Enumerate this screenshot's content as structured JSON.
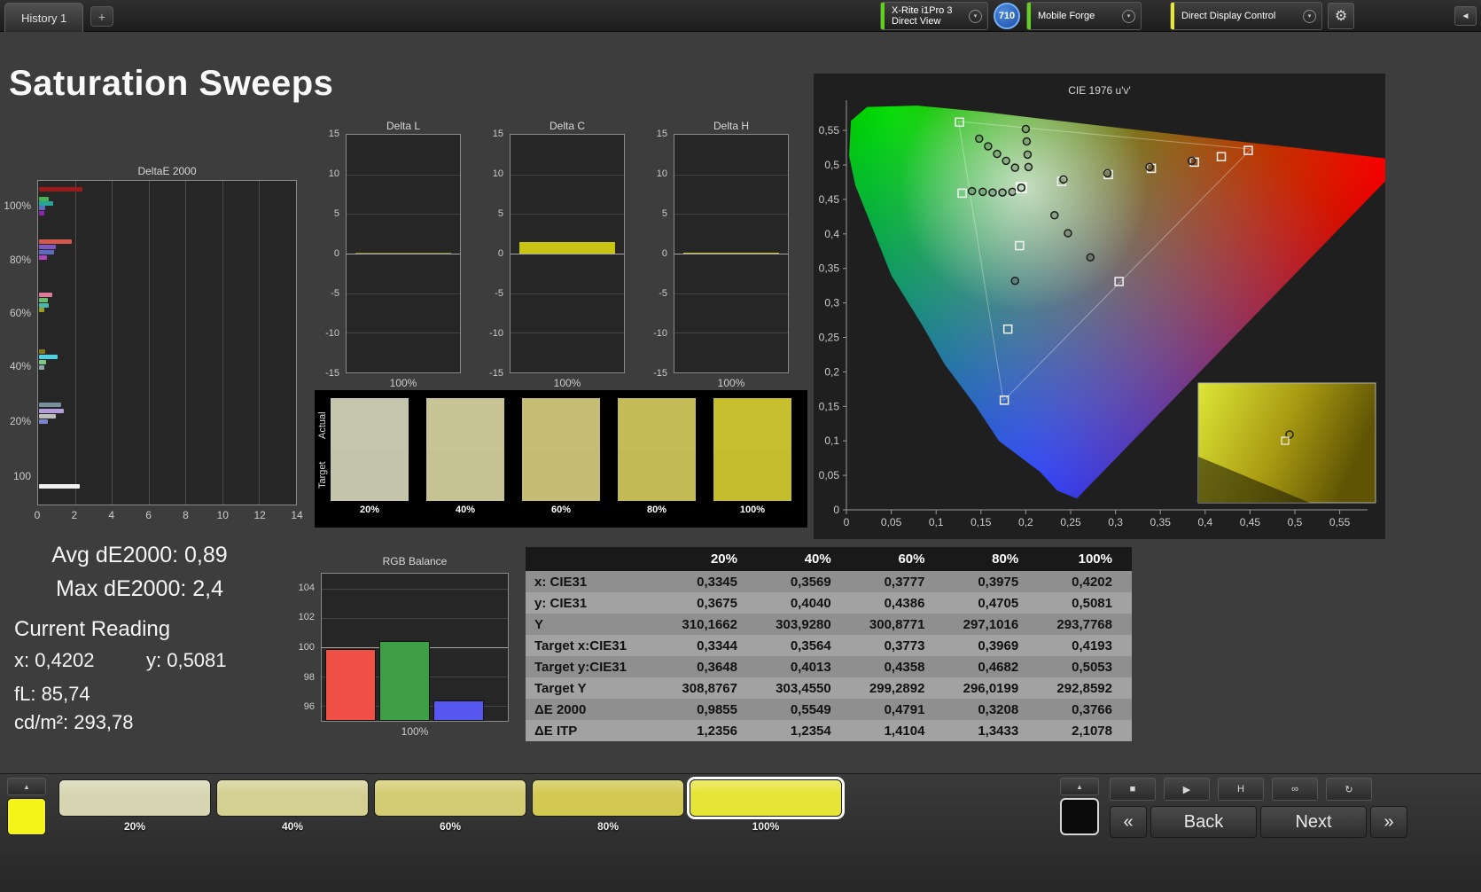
{
  "window": {
    "tab_label": "History 1",
    "add_tab_label": "+",
    "meter_dropdown": {
      "line1": "X-Rite i1Pro 3",
      "line2": "Direct View",
      "accent": "#5fd317"
    },
    "meter_badge": "710",
    "workflow_dropdown": {
      "label": "Mobile Forge",
      "accent": "#5fd317"
    },
    "display_dropdown": {
      "label": "Direct Display Control",
      "accent": "#e8e833"
    },
    "gear_icon": "⚙",
    "collapse_icon": "◄",
    "chevron": "▾"
  },
  "page_title": "Saturation Sweeps",
  "readings": {
    "avg_de": "Avg dE2000: 0,89",
    "max_de": "Max dE2000: 2,4",
    "current_heading": "Current Reading",
    "x": "x: 0,4202",
    "y": "y: 0,5081",
    "fl": "fL: 85,74",
    "cd": "cd/m²: 293,78"
  },
  "swatch_strip": {
    "row_labels": [
      "Actual",
      "Target"
    ],
    "columns": [
      "20%",
      "40%",
      "60%",
      "80%",
      "100%"
    ],
    "actual_colors": [
      "#c6c6ae",
      "#c8c494",
      "#c6be75",
      "#c5bc57",
      "#c7bf2e"
    ],
    "target_colors": [
      "#c4c4ac",
      "#c6c292",
      "#c4bc73",
      "#c3ba55",
      "#c5bd2c"
    ]
  },
  "measurement_table": {
    "columns": [
      "20%",
      "40%",
      "60%",
      "80%",
      "100%"
    ],
    "rows": [
      {
        "label": "x: CIE31",
        "values": [
          "0,3345",
          "0,3569",
          "0,3777",
          "0,3975",
          "0,4202"
        ]
      },
      {
        "label": "y: CIE31",
        "values": [
          "0,3675",
          "0,4040",
          "0,4386",
          "0,4705",
          "0,5081"
        ]
      },
      {
        "label": "Y",
        "values": [
          "310,1662",
          "303,9280",
          "300,8771",
          "297,1016",
          "293,7768"
        ]
      },
      {
        "label": "Target x:CIE31",
        "values": [
          "0,3344",
          "0,3564",
          "0,3773",
          "0,3969",
          "0,4193"
        ]
      },
      {
        "label": "Target y:CIE31",
        "values": [
          "0,3648",
          "0,4013",
          "0,4358",
          "0,4682",
          "0,5053"
        ]
      },
      {
        "label": "Target Y",
        "values": [
          "308,8767",
          "303,4550",
          "299,2892",
          "296,0199",
          "292,8592"
        ]
      },
      {
        "label": "ΔE 2000",
        "values": [
          "0,9855",
          "0,5549",
          "0,4791",
          "0,3208",
          "0,3766"
        ]
      },
      {
        "label": "ΔE ITP",
        "values": [
          "1,2356",
          "1,2354",
          "1,4104",
          "1,3433",
          "2,1078"
        ]
      }
    ]
  },
  "chart_data": [
    {
      "id": "deltae2000",
      "type": "bar",
      "orientation": "horizontal",
      "title": "DeltaE 2000",
      "xlabel": "",
      "ylabel": "",
      "xlim": [
        0,
        14
      ],
      "xticks": [
        "0",
        "2",
        "4",
        "6",
        "8",
        "10",
        "12",
        "14"
      ],
      "row_labels": [
        {
          "text": "100%",
          "pos": 0.08
        },
        {
          "text": "80%",
          "pos": 0.245
        },
        {
          "text": "60%",
          "pos": 0.41
        },
        {
          "text": "40%",
          "pos": 0.573
        },
        {
          "text": "20%",
          "pos": 0.74
        },
        {
          "text": "100",
          "pos": 0.91
        }
      ],
      "bars": [
        {
          "pos": 0.018,
          "value": 2.35,
          "color": "#9b1b1b"
        },
        {
          "pos": 0.05,
          "value": 0.55,
          "color": "#4caf50"
        },
        {
          "pos": 0.064,
          "value": 0.75,
          "color": "#26a69a"
        },
        {
          "pos": 0.078,
          "value": 0.35,
          "color": "#5c6bc0"
        },
        {
          "pos": 0.092,
          "value": 0.3,
          "color": "#8e24aa"
        },
        {
          "pos": 0.182,
          "value": 1.8,
          "color": "#d4584e"
        },
        {
          "pos": 0.198,
          "value": 0.9,
          "color": "#7e57c2"
        },
        {
          "pos": 0.214,
          "value": 0.8,
          "color": "#5c6bc0"
        },
        {
          "pos": 0.23,
          "value": 0.45,
          "color": "#ab47bc"
        },
        {
          "pos": 0.345,
          "value": 0.7,
          "color": "#e07a9a"
        },
        {
          "pos": 0.361,
          "value": 0.5,
          "color": "#66bb6a"
        },
        {
          "pos": 0.377,
          "value": 0.55,
          "color": "#4db6ac"
        },
        {
          "pos": 0.393,
          "value": 0.3,
          "color": "#9e9d24"
        },
        {
          "pos": 0.52,
          "value": 0.35,
          "color": "#827717"
        },
        {
          "pos": 0.537,
          "value": 1.0,
          "color": "#4dd0e1"
        },
        {
          "pos": 0.553,
          "value": 0.4,
          "color": "#81c784"
        },
        {
          "pos": 0.57,
          "value": 0.3,
          "color": "#90a4ae"
        },
        {
          "pos": 0.685,
          "value": 1.2,
          "color": "#78909c"
        },
        {
          "pos": 0.703,
          "value": 1.35,
          "color": "#b39ddb"
        },
        {
          "pos": 0.72,
          "value": 0.9,
          "color": "#bdbdbd"
        },
        {
          "pos": 0.738,
          "value": 0.5,
          "color": "#7986cb"
        },
        {
          "pos": 0.938,
          "value": 2.2,
          "color": "#f0f0f0"
        }
      ]
    },
    {
      "id": "delta_l",
      "type": "bar",
      "title": "Delta L",
      "ylim": [
        -15,
        15
      ],
      "yticks": [
        "15",
        "10",
        "5",
        "0",
        "-5",
        "-10",
        "-15"
      ],
      "categories": [
        "100%"
      ],
      "values": [
        0.15
      ],
      "bar_color": "#8a8a30"
    },
    {
      "id": "delta_c",
      "type": "bar",
      "title": "Delta C",
      "ylim": [
        -15,
        15
      ],
      "yticks": [
        "15",
        "10",
        "5",
        "0",
        "-5",
        "-10",
        "-15"
      ],
      "categories": [
        "100%"
      ],
      "values": [
        1.5
      ],
      "bar_color": "#c9c414"
    },
    {
      "id": "delta_h",
      "type": "bar",
      "title": "Delta H",
      "ylim": [
        -15,
        15
      ],
      "yticks": [
        "15",
        "10",
        "5",
        "0",
        "-5",
        "-10",
        "-15"
      ],
      "categories": [
        "100%"
      ],
      "values": [
        0.05
      ],
      "bar_color": "#c9c414"
    },
    {
      "id": "rgb_balance",
      "type": "bar",
      "title": "RGB Balance",
      "ylim": [
        95,
        105
      ],
      "yticks": [
        "104",
        "102",
        "100",
        "98",
        "96"
      ],
      "categories": [
        "100%"
      ],
      "series": [
        {
          "name": "Red",
          "value": 99.9,
          "color": "#ef4f45"
        },
        {
          "name": "Green",
          "value": 100.4,
          "color": "#3f9f46"
        },
        {
          "name": "Blue",
          "value": 96.4,
          "color": "#5757ef"
        }
      ]
    },
    {
      "id": "cie",
      "type": "scatter",
      "title": "CIE 1976 u'v'",
      "xlim": [
        0,
        0.6
      ],
      "ylim": [
        0,
        0.6
      ],
      "xticks": [
        "0",
        "0,05",
        "0,1",
        "0,15",
        "0,2",
        "0,25",
        "0,3",
        "0,35",
        "0,4",
        "0,45",
        "0,5",
        "0,55"
      ],
      "yticks": [
        "0",
        "0,05",
        "0,1",
        "0,15",
        "0,2",
        "0,25",
        "0,3",
        "0,35",
        "0,4",
        "0,45",
        "0,5",
        "0,55"
      ],
      "measured": [
        [
          0.148,
          0.538
        ],
        [
          0.158,
          0.527
        ],
        [
          0.168,
          0.516
        ],
        [
          0.178,
          0.506
        ],
        [
          0.188,
          0.496
        ],
        [
          0.2,
          0.552
        ],
        [
          0.201,
          0.534
        ],
        [
          0.202,
          0.515
        ],
        [
          0.203,
          0.497
        ],
        [
          0.14,
          0.462
        ],
        [
          0.152,
          0.461
        ],
        [
          0.163,
          0.46
        ],
        [
          0.174,
          0.46
        ],
        [
          0.185,
          0.461
        ],
        [
          0.242,
          0.479
        ],
        [
          0.291,
          0.488
        ],
        [
          0.338,
          0.497
        ],
        [
          0.385,
          0.506
        ],
        [
          0.232,
          0.427
        ],
        [
          0.247,
          0.401
        ],
        [
          0.272,
          0.366
        ],
        [
          0.188,
          0.332
        ]
      ],
      "targets": [
        [
          0.126,
          0.562
        ],
        [
          0.448,
          0.521
        ],
        [
          0.176,
          0.159
        ],
        [
          0.129,
          0.459
        ],
        [
          0.18,
          0.262
        ],
        [
          0.304,
          0.331
        ],
        [
          0.193,
          0.383
        ],
        [
          0.24,
          0.476
        ],
        [
          0.292,
          0.486
        ],
        [
          0.34,
          0.495
        ],
        [
          0.388,
          0.504
        ],
        [
          0.418,
          0.512
        ]
      ],
      "current": [
        0.195,
        0.467
      ],
      "inset_marker": [
        0.515,
        0.43
      ]
    }
  ],
  "bottom_bar": {
    "sample_color": "#f4f418",
    "up_arrow": "▲",
    "patches": [
      {
        "label": "20%",
        "color": "#d6d6b2",
        "selected": false
      },
      {
        "label": "40%",
        "color": "#d4d092",
        "selected": false
      },
      {
        "label": "60%",
        "color": "#d4cc72",
        "selected": false
      },
      {
        "label": "80%",
        "color": "#d2c852",
        "selected": false
      },
      {
        "label": "100%",
        "color": "#e6e434",
        "selected": true
      }
    ],
    "transport": [
      {
        "name": "stop",
        "glyph": "■"
      },
      {
        "name": "play",
        "glyph": "▶"
      },
      {
        "name": "h-marker",
        "glyph": "H"
      },
      {
        "name": "loop",
        "glyph": "∞"
      },
      {
        "name": "refresh",
        "glyph": "↻"
      }
    ],
    "nav": {
      "prev": "«",
      "back": "Back",
      "next": "Next",
      "fwd": "»"
    }
  }
}
